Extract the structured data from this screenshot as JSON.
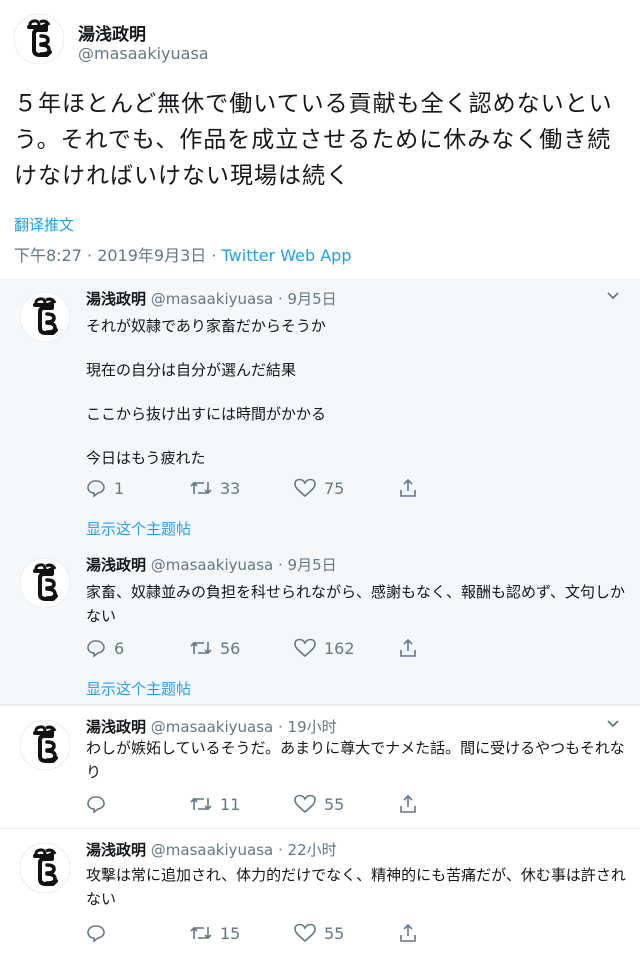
{
  "main": {
    "name": "湯浅政明",
    "handle": "@masaakiyuasa",
    "text": "５年ほとんど無休で働いている貢献も全く認めないという。それでも、作品を成立させるために休みなく働き続けなければいけない現場は続く",
    "translate": "翻译推文",
    "timestamp": "下午8:27 · 2019年9月3日 · ",
    "app": "Twitter Web App"
  },
  "replies": [
    {
      "name": "湯浅政明",
      "handle": "@masaakiyuasa · 9月5日",
      "lines": [
        "それが奴隷であり家畜だからそうか",
        "現在の自分は自分が選んだ結果",
        "ここから抜け出すには時間がかかる",
        "今日はもう疲れた"
      ],
      "replies": "1",
      "retweets": "33",
      "likes": "75",
      "show_thread": "显示这个主题帖"
    },
    {
      "name": "湯浅政明",
      "handle": "@masaakiyuasa · 9月5日",
      "text": "家畜、奴隷並みの負担を科せられながら、感謝もなく、報酬も認めず、文句しかない",
      "replies": "6",
      "retweets": "56",
      "likes": "162",
      "show_thread": "显示这个主题帖"
    },
    {
      "name": "湯浅政明",
      "handle": "@masaakiyuasa · 19小时",
      "text": "わしが嫉妬しているそうだ。あまりに尊大でナメた話。間に受けるやつもそれなり",
      "replies": "",
      "retweets": "11",
      "likes": "55"
    },
    {
      "name": "湯浅政明",
      "handle": "@masaakiyuasa · 22小时",
      "text": "攻撃は常に追加され、体力的だけでなく、精神的にも苦痛だが、休む事は許されない",
      "replies": "",
      "retweets": "15",
      "likes": "55"
    }
  ],
  "icons": {
    "reply": "reply-icon",
    "retweet": "retweet-icon",
    "like": "heart-icon",
    "share": "share-icon",
    "more": "chevron-down-icon"
  },
  "colors": {
    "link": "#1da1f2",
    "muted": "#657786",
    "reply_bg": "#f5f8fa"
  }
}
